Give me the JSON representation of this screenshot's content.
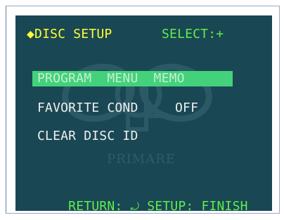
{
  "header": {
    "title": "◆DISC SETUP",
    "hint": "SELECT:+"
  },
  "menu": {
    "items": [
      {
        "label": "PROGRAM  MENU  MEMO",
        "selected": true
      },
      {
        "label": "FAVORITE COND",
        "value": "OFF"
      },
      {
        "label": "CLEAR DISC ID"
      }
    ]
  },
  "watermark": {
    "brand": "PRIMARE"
  },
  "footer": {
    "text": "RETURN: ",
    "return_icon": "return-arrow-icon",
    "text2": " SETUP: FINISH"
  },
  "colors": {
    "background": "#1a4754",
    "title": "#ffff33",
    "hint": "#5cf04b",
    "highlight": "#43d27b",
    "text": "#eef0ee",
    "footer": "#5cf04b"
  }
}
